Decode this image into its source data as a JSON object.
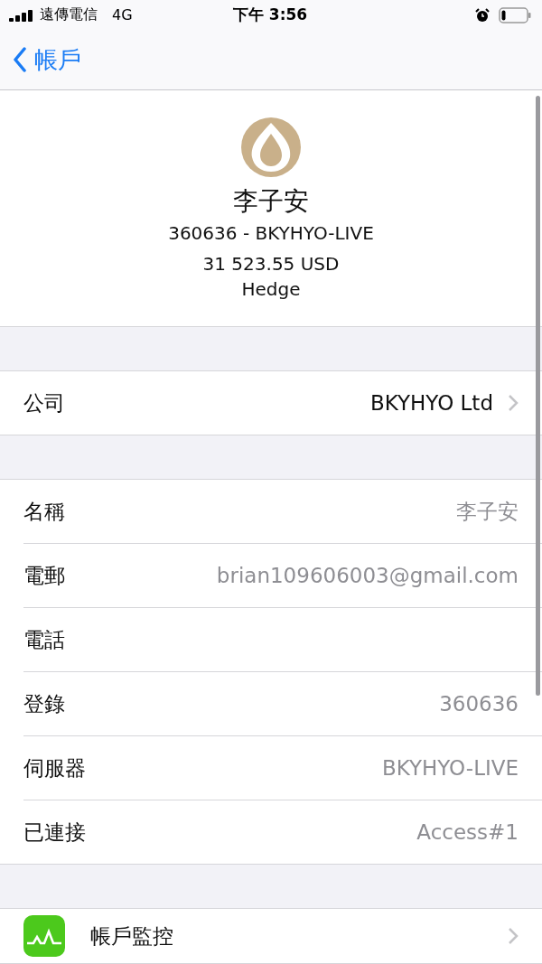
{
  "status_bar": {
    "carrier": "遠傳電信",
    "network": "4G",
    "time": "下午 3:56"
  },
  "nav": {
    "back_label": "帳戶"
  },
  "account": {
    "name": "李子安",
    "login_server": "360636 - BKYHYO-LIVE",
    "balance": "31 523.55 USD",
    "mode": "Hedge"
  },
  "company": {
    "label": "公司",
    "value": "BKYHYO Ltd"
  },
  "details": [
    {
      "label": "名稱",
      "value": "李子安"
    },
    {
      "label": "電郵",
      "value": "brian109606003@gmail.com"
    },
    {
      "label": "電話"
    },
    {
      "label": "登錄",
      "value": "360636"
    },
    {
      "label": "伺服器",
      "value": "BKYHYO-LIVE"
    },
    {
      "label": "已連接",
      "value": "Access#1"
    }
  ],
  "monitor": {
    "label": "帳戶監控"
  }
}
